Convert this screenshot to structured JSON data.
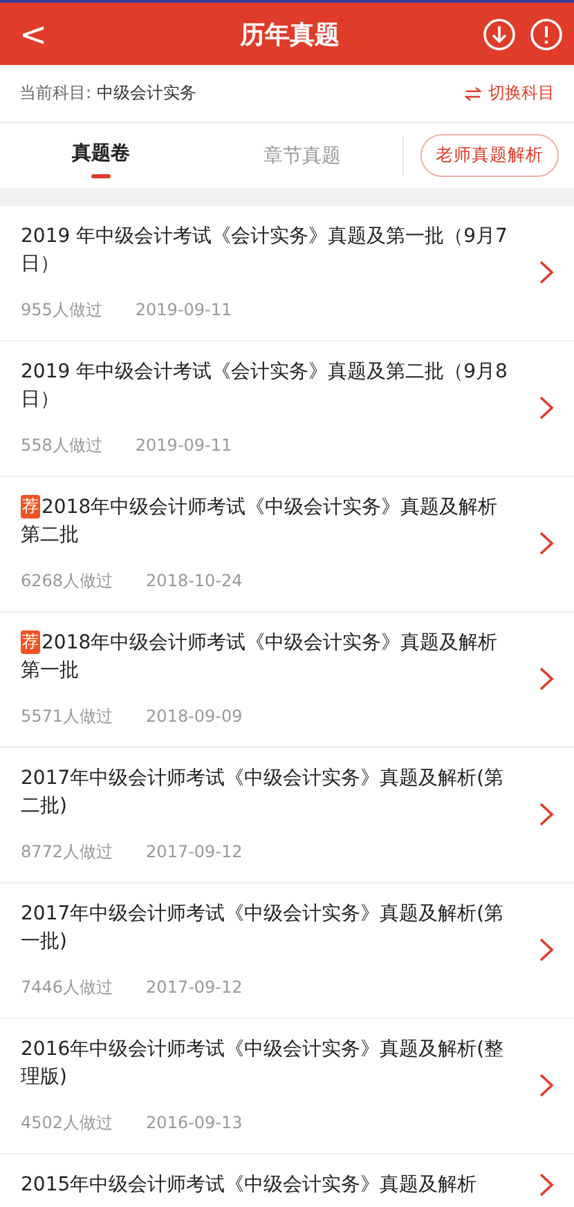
{
  "header": {
    "back": "<",
    "title": "历年真题"
  },
  "subject": {
    "label": "当前科目:",
    "value": "中级会计实务",
    "switch": "切换科目"
  },
  "tabs": [
    {
      "label": "真题卷",
      "selected": true
    },
    {
      "label": "章节真题",
      "selected": false
    }
  ],
  "teacher_button": "老师真题解析",
  "papers": [
    {
      "title": "2019 年中级会计考试《会计实务》真题及第一批（9月7日）",
      "count": "955人做过",
      "date": "2019-09-11"
    },
    {
      "title": "2019 年中级会计考试《会计实务》真题及第二批（9月8日）",
      "count": "558人做过",
      "date": "2019-09-11"
    },
    {
      "badge": "荐",
      "title": "2018年中级会计师考试《中级会计实务》真题及解析第二批",
      "count": "6268人做过",
      "date": "2018-10-24"
    },
    {
      "badge": "荐",
      "title": "2018年中级会计师考试《中级会计实务》真题及解析第一批",
      "count": "5571人做过",
      "date": "2018-09-09"
    },
    {
      "title": "2017年中级会计师考试《中级会计实务》真题及解析(第二批)",
      "count": "8772人做过",
      "date": "2017-09-12"
    },
    {
      "title": "2017年中级会计师考试《中级会计实务》真题及解析(第一批)",
      "count": "7446人做过",
      "date": "2017-09-12"
    },
    {
      "title": "2016年中级会计师考试《中级会计实务》真题及解析(整理版)",
      "count": "4502人做过",
      "date": "2016-09-13"
    },
    {
      "title": "2015年中级会计师考试《中级会计实务》真题及解析"
    }
  ]
}
